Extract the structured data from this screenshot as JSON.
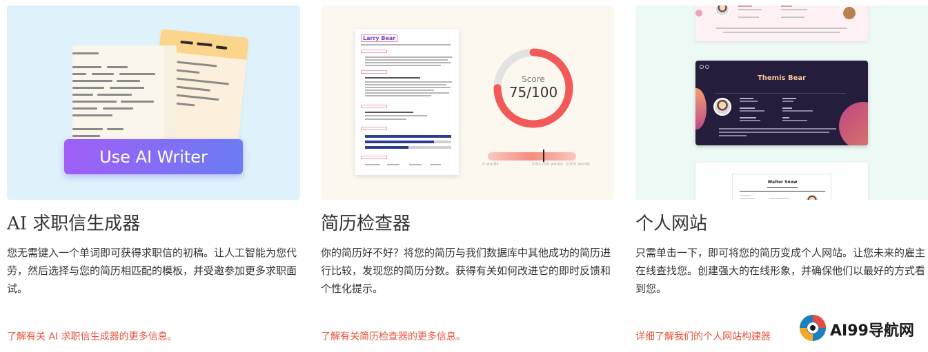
{
  "cards": [
    {
      "title": "AI 求职信生成器",
      "description": "您无需键入一个单词即可获得求职信的初稿。让人工智能为您代劳，然后选择与您的简历相匹配的模板，并受邀参加更多求职面试。",
      "link": "了解有关 AI 求职信生成器的更多信息。",
      "hero": {
        "button_label": "Use AI Writer"
      }
    },
    {
      "title": "简历检查器",
      "description": "你的简历好不好？将您的简历与我们数据库中其他成功的简历进行比较，发现您的简历分数。获得有关如何改进它的即时反馈和个性化提示。",
      "link": "了解有关简历检查器的更多信息。",
      "hero": {
        "resume_name": "Larry Bear",
        "score_label": "Score",
        "score_value": "75/100",
        "score_fraction": 0.75,
        "word_scale": [
          "0 words",
          "500-700 words",
          "1000 words"
        ]
      }
    },
    {
      "title": "个人网站",
      "description": "只需单击一下，即可将您的简历变成个人网站。让您未来的雇主在线查找您。创建强大的在线形象，并确保他们以最好的方式看到您。",
      "link": "详细了解我们的个人网站构建器",
      "hero": {
        "site_name": "Themis Bear",
        "bottom_name": "Walter Snow"
      }
    }
  ],
  "watermark": {
    "text": "AI99导航网"
  },
  "colors": {
    "link": "#e8533b",
    "button_start": "#a05ef6",
    "button_end": "#6a7cf4",
    "gauge": "#f25a5a"
  }
}
